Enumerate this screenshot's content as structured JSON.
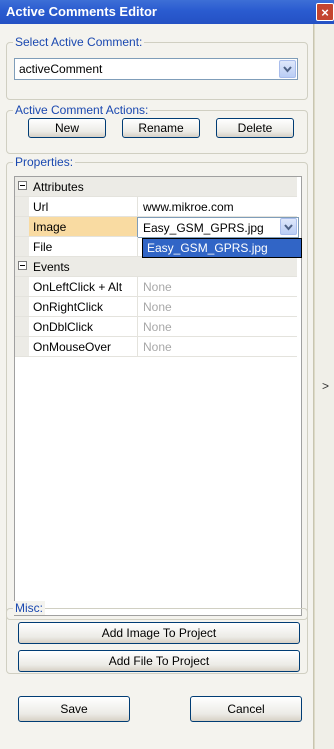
{
  "window": {
    "title": "Active Comments Editor",
    "close_glyph": "×"
  },
  "select_group": {
    "legend": "Select Active Comment:",
    "selected": "activeComment"
  },
  "actions_group": {
    "legend": "Active Comment Actions:",
    "new": "New",
    "rename": "Rename",
    "delete": "Delete"
  },
  "properties_group": {
    "legend": "Properties:",
    "attributes_label": "Attributes",
    "attributes": [
      {
        "name": "Url",
        "value": "www.mikroe.com"
      },
      {
        "name": "Image",
        "value": "Easy_GSM_GPRS.jpg"
      },
      {
        "name": "File",
        "value": ""
      }
    ],
    "dropdown_option": "Easy_GSM_GPRS.jpg",
    "events_label": "Events",
    "events": [
      {
        "name": "OnLeftClick + Alt",
        "value": "None"
      },
      {
        "name": "OnRightClick",
        "value": "None"
      },
      {
        "name": "OnDblClick",
        "value": "None"
      },
      {
        "name": "OnMouseOver",
        "value": "None"
      }
    ]
  },
  "misc_group": {
    "legend": "Misc:",
    "add_image": "Add Image To Project",
    "add_file": "Add File  To Project"
  },
  "footer": {
    "save": "Save",
    "cancel": "Cancel"
  },
  "side_strip": {
    "arrow": ">"
  },
  "colors": {
    "title_bar": "#2a5bd0",
    "legend_text": "#1a48b0",
    "selection": "#3165c6",
    "highlight_cell": "#f9dba2"
  }
}
